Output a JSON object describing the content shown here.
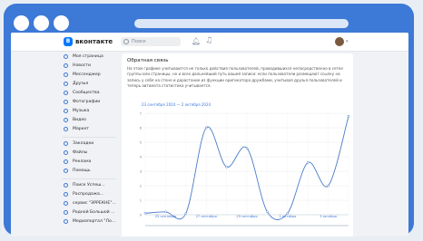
{
  "browser": {},
  "header": {
    "logo_mark": "В",
    "logo_text": "вконтакте",
    "search_placeholder": "Поиск"
  },
  "sidebar": {
    "items": [
      {
        "label": "Моя страница",
        "icon": "user-icon"
      },
      {
        "label": "Новости",
        "icon": "news-icon"
      },
      {
        "label": "Мессенджер",
        "icon": "message-icon"
      },
      {
        "label": "Друзья",
        "icon": "friends-icon"
      },
      {
        "label": "Сообщества",
        "icon": "communities-icon"
      },
      {
        "label": "Фотографии",
        "icon": "photo-icon"
      },
      {
        "label": "Музыка",
        "icon": "music-icon"
      },
      {
        "label": "Видео",
        "icon": "video-icon"
      },
      {
        "label": "Маркет",
        "icon": "market-icon"
      },
      {
        "label": "Закладки",
        "icon": "bookmark-icon"
      },
      {
        "label": "Файлы",
        "icon": "file-icon"
      },
      {
        "label": "Реклама",
        "icon": "ads-icon"
      },
      {
        "label": "Помощь",
        "icon": "help-icon"
      },
      {
        "label": "Поиск Успеш...",
        "icon": "group-icon"
      },
      {
        "label": "Распродажа...",
        "icon": "group-icon"
      },
      {
        "label": "сервис \"ЭРРЕКНЕ\"...",
        "icon": "group-icon"
      },
      {
        "label": "Родной Большой ...",
        "icon": "group-icon"
      },
      {
        "label": "Медиапортал \"Ло...",
        "icon": "group-icon"
      }
    ]
  },
  "content": {
    "title": "Обратная связь",
    "description": "На этом графике учитываются не только действия пользователей, проводившихся непосредственно в сетке группы или страницы, но и всех дальнейший путь вашей записи: если пользователи размещают ссылку на запись у себя на стене и дорастание из функции оригинатора дружбами, учитывая друзья пользователей и теперь автомата статистика учитывается.",
    "date_range": "23 сентября 2024 — 2 октября 2024"
  },
  "chart_data": {
    "type": "line",
    "title": "",
    "x": [
      "25 сентября",
      "27 сентября",
      "29 сентября",
      "1 октября",
      "3 октября"
    ],
    "x_ticks": [
      "25 сентября",
      "27 сентября",
      "29 сентября",
      "1 октября",
      "3 октября"
    ],
    "y_ticks": [
      "0",
      "1",
      "2",
      "3",
      "4",
      "5",
      "6",
      "7"
    ],
    "ylim": [
      0,
      7
    ],
    "series": [
      {
        "values": [
          0.1,
          0.2,
          0.1,
          6.0,
          3.3,
          4.6,
          0.2,
          0.1,
          3.6,
          2.0,
          6.8
        ]
      }
    ],
    "grid": true,
    "color": "#4a7bc8"
  }
}
